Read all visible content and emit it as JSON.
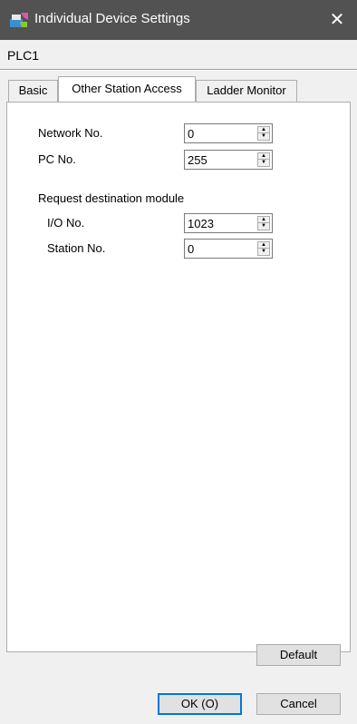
{
  "window": {
    "title": "Individual Device Settings",
    "device_name": "PLC1"
  },
  "tabs": [
    {
      "label": "Basic",
      "active": false
    },
    {
      "label": "Other Station Access",
      "active": true
    },
    {
      "label": "Ladder Monitor",
      "active": false
    }
  ],
  "form": {
    "network_no_label": "Network No.",
    "network_no_value": "0",
    "pc_no_label": "PC No.",
    "pc_no_value": "255",
    "request_dest_label": "Request destination module",
    "io_no_label": "I/O No.",
    "io_no_value": "1023",
    "station_no_label": "Station No.",
    "station_no_value": "0"
  },
  "buttons": {
    "default": "Default",
    "ok": "OK (O)",
    "cancel": "Cancel"
  },
  "icons": {
    "app": "device-settings-icon",
    "close": "close-icon"
  },
  "colors": {
    "titlebar": "#525252",
    "accent": "#0078d7",
    "window_bg": "#f0f0f0"
  }
}
